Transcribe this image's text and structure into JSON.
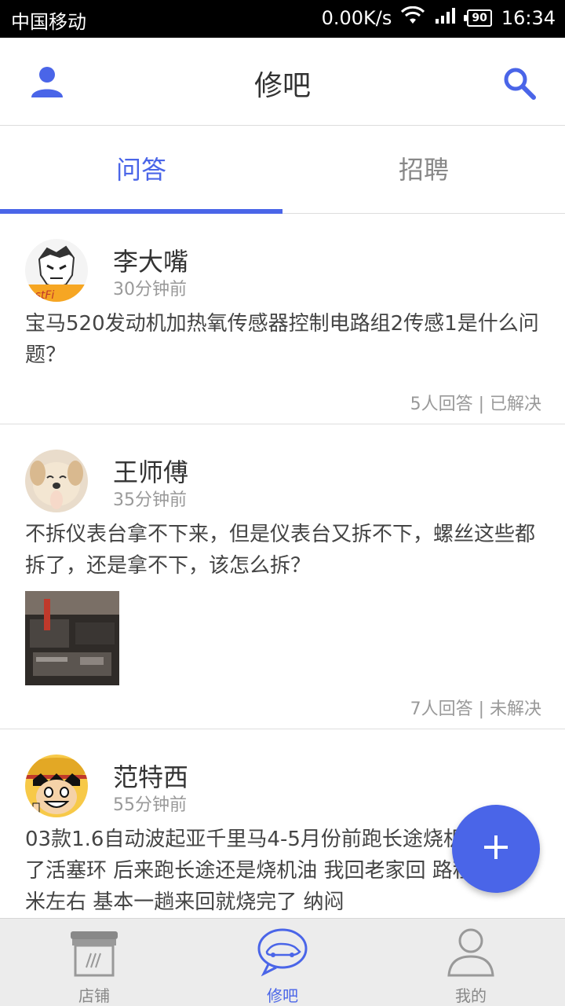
{
  "status_bar": {
    "carrier": "中国移动",
    "network_speed": "0.00K/s",
    "battery": "90",
    "time": "16:34"
  },
  "header": {
    "title": "修吧",
    "user_icon": "user-icon",
    "search_icon": "search-icon"
  },
  "tabs": [
    {
      "label": "问答",
      "active": true
    },
    {
      "label": "招聘",
      "active": false
    }
  ],
  "posts": [
    {
      "name": "李大嘴",
      "time": "30分钟前",
      "content": "宝马520发动机加热氧传感器控制电路组2传感1是什么问题？",
      "meta": "5人回答 | 已解决"
    },
    {
      "name": "王师傅",
      "time": "35分钟前",
      "content": "不拆仪表台拿不下来，但是仪表台又拆不下，螺丝这些都拆了，还是拿不下，该怎么拆？",
      "meta": "7人回答 | 未解决"
    },
    {
      "name": "范特西",
      "time": "55分钟前",
      "content": "03款1.6自动波起亚千里马4-5月份前跑长途烧机油 来换了活塞环  后来跑长途还是烧机油  我回老家回 路程700千米左右 基本一趟来回就烧完了 纳闷"
    }
  ],
  "fab": {
    "icon": "plus-icon"
  },
  "bottom_nav": [
    {
      "label": "店铺",
      "icon": "shop-icon",
      "active": false
    },
    {
      "label": "修吧",
      "icon": "chat-car-icon",
      "active": true
    },
    {
      "label": "我的",
      "icon": "profile-icon",
      "active": false
    }
  ],
  "colors": {
    "accent": "#4a65e8",
    "text": "#333333",
    "muted": "#999999",
    "nav_bg": "#ececec"
  }
}
